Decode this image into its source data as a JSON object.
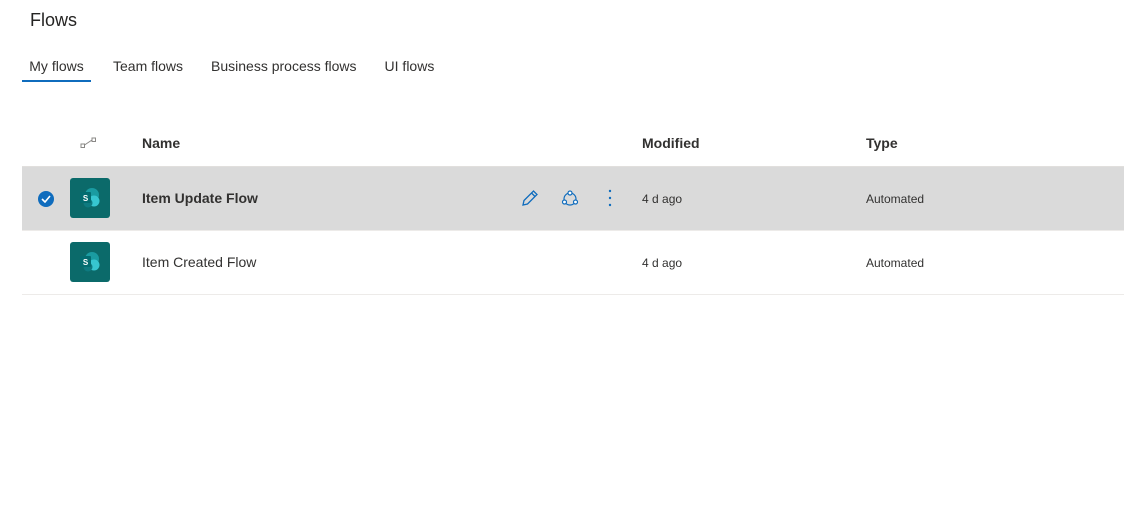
{
  "page": {
    "title": "Flows"
  },
  "tabs": [
    {
      "label": "My flows",
      "active": true
    },
    {
      "label": "Team flows",
      "active": false
    },
    {
      "label": "Business process flows",
      "active": false
    },
    {
      "label": "UI flows",
      "active": false
    }
  ],
  "columns": {
    "name": "Name",
    "modified": "Modified",
    "type": "Type",
    "icon": "flow-type-icon"
  },
  "rows": [
    {
      "name": "Item Update Flow",
      "modified": "4 d ago",
      "type": "Automated",
      "selected": true,
      "icon": "sharepoint-icon"
    },
    {
      "name": "Item Created Flow",
      "modified": "4 d ago",
      "type": "Automated",
      "selected": false,
      "icon": "sharepoint-icon"
    }
  ],
  "row_actions": [
    "edit-icon",
    "share-icon",
    "more-options-icon"
  ],
  "colors": {
    "accent": "#0f6cbd",
    "selected_row": "#dadada",
    "sharepoint": "#0b6a6a"
  }
}
